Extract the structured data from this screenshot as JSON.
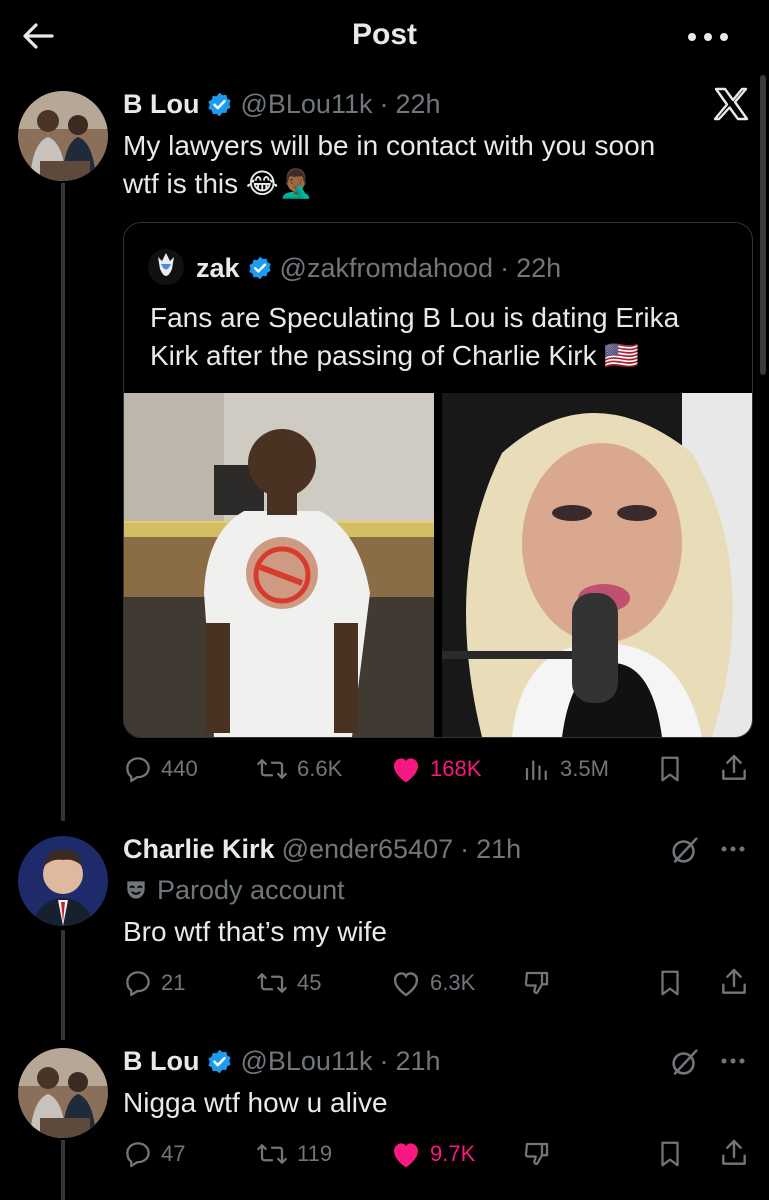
{
  "header": {
    "title": "Post"
  },
  "main_post": {
    "name": "B Lou",
    "handle": "@BLou11k",
    "sep": "·",
    "time": "22h",
    "text_line1": "My lawyers will be in contact with you soon",
    "text_line2": "wtf is this",
    "emoji": "😂🤦🏾‍♂️",
    "source_icon": "x-logo-icon",
    "quote": {
      "name": "zak",
      "handle": "@zakfromdahood",
      "sep": "·",
      "time": "22h",
      "text_line1": "Fans are Speculating B Lou is dating Erika",
      "text_line2": "Kirk after the passing of Charlie Kirk",
      "flag": "🇺🇸"
    },
    "stats": {
      "replies": "440",
      "reposts": "6.6K",
      "likes": "168K",
      "views": "3.5M"
    }
  },
  "replies": [
    {
      "name": "Charlie Kirk",
      "handle": "@ender65407",
      "sep": "·",
      "time": "21h",
      "label": "Parody account",
      "text": "Bro wtf that’s my wife",
      "stats": {
        "replies": "21",
        "reposts": "45",
        "likes": "6.3K"
      }
    },
    {
      "name": "B Lou",
      "handle": "@BLou11k",
      "sep": "·",
      "time": "21h",
      "text": "Nigga wtf how u alive",
      "stats": {
        "replies": "47",
        "reposts": "119",
        "likes": "9.7K"
      }
    }
  ],
  "colors": {
    "accent": "#1d9bf0",
    "like": "#f91880",
    "muted": "#71767b",
    "text": "#e7e9ea",
    "background": "#000000"
  }
}
